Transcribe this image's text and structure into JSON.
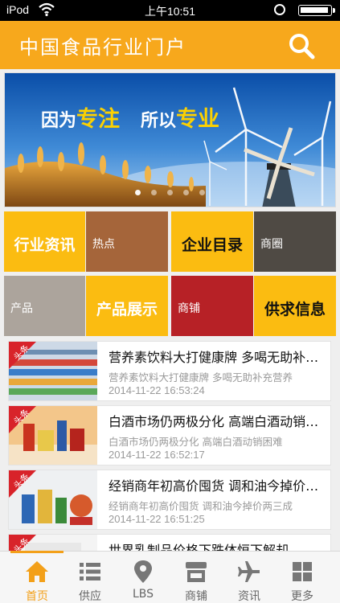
{
  "status_bar": {
    "carrier": "iPod",
    "time": "上午10:51"
  },
  "nav": {
    "title": "中国食品行业门户"
  },
  "banner": {
    "part1": "因为",
    "emph1": "专注",
    "part2": "所以",
    "emph2": "专业",
    "slides": 5,
    "active_slide": 0
  },
  "tiles": [
    {
      "label": "行业资讯"
    },
    {
      "label": "热点"
    },
    {
      "label": "企业目录"
    },
    {
      "label": "商圈"
    },
    {
      "label": "产品"
    },
    {
      "label": "产品展示"
    },
    {
      "label": "商铺"
    },
    {
      "label": "供求信息"
    }
  ],
  "tag_label": "头条",
  "news": [
    {
      "headline": "营养素饮料大打健康牌 多喝无助补充营养",
      "summary": "营养素饮料大打健康牌 多喝无助补充营养",
      "date": "2014-11-22 16:53:24"
    },
    {
      "headline": "白酒市场仍两极分化 高端白酒动销困难",
      "summary": "白酒市场仍两极分化 高端白酒动销困难",
      "date": "2014-11-22 16:52:17"
    },
    {
      "headline": "经销商年初高价囤货 调和油今掉价两三成",
      "summary": "经销商年初高价囤货 调和油今掉价两三成",
      "date": "2014-11-22 16:51:25"
    },
    {
      "headline": "世界乳制品价格下跌体恒下解却",
      "summary": "",
      "date": ""
    }
  ],
  "tabs": [
    {
      "label": "首页",
      "icon": "home-icon",
      "active": true
    },
    {
      "label": "供应",
      "icon": "list-icon",
      "active": false
    },
    {
      "label": "LBS",
      "icon": "location-pin-icon",
      "active": false
    },
    {
      "label": "商铺",
      "icon": "shop-icon",
      "active": false
    },
    {
      "label": "资讯",
      "icon": "airplane-icon",
      "active": false
    },
    {
      "label": "更多",
      "icon": "grid-icon",
      "active": false
    }
  ],
  "colors": {
    "accent": "#f7a81c",
    "tile_yellow": "#fbbc11",
    "tile_brown": "#a5653a",
    "tile_dark": "#4f4a44",
    "tile_gray": "#aca49c",
    "tile_red": "#b72126"
  }
}
